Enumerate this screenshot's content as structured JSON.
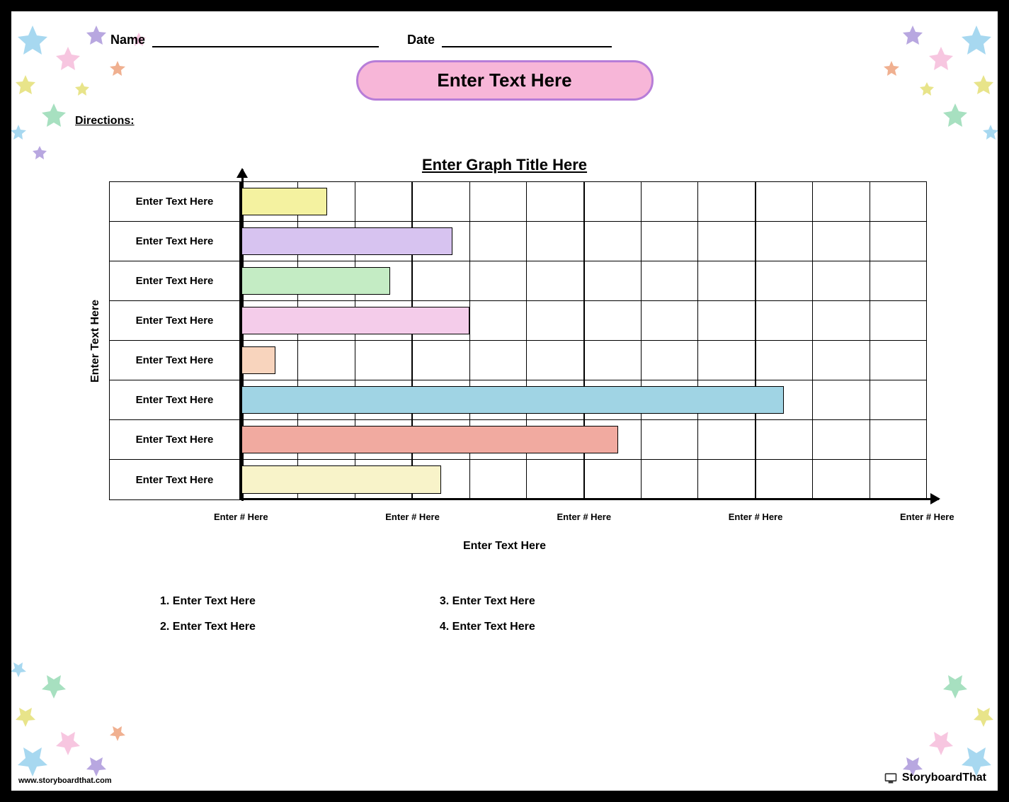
{
  "header": {
    "name_label": "Name",
    "date_label": "Date"
  },
  "title": "Enter Text Here",
  "directions_label": "Directions:",
  "chart_data": {
    "type": "bar",
    "orientation": "horizontal",
    "title": "Enter Graph Title Here",
    "ylabel": "Enter Text Here",
    "xlabel": "Enter Text Here",
    "x_ticks": [
      "Enter # Here",
      "Enter # Here",
      "Enter # Here",
      "Enter # Here",
      "Enter # Here"
    ],
    "categories": [
      "Enter Text Here",
      "Enter Text Here",
      "Enter Text Here",
      "Enter Text Here",
      "Enter Text Here",
      "Enter Text Here",
      "Enter Text Here",
      "Enter Text Here"
    ],
    "values": [
      1.5,
      3.7,
      2.6,
      4.0,
      0.6,
      9.5,
      6.6,
      3.5
    ],
    "xlim": [
      0,
      12
    ],
    "colors": [
      "#f4f2a0",
      "#d7c3f0",
      "#c4ecc4",
      "#f4ccea",
      "#f8d4bd",
      "#a0d4e4",
      "#f1aaa0",
      "#f8f3c9"
    ],
    "major_gridlines": [
      3,
      6,
      9
    ]
  },
  "questions": {
    "col1": [
      "1. Enter Text Here",
      "2. Enter Text Here"
    ],
    "col2": [
      "3. Enter Text Here",
      "4. Enter Text Here"
    ]
  },
  "footer": {
    "url": "www.storyboardthat.com",
    "brand": "StoryboardThat"
  }
}
